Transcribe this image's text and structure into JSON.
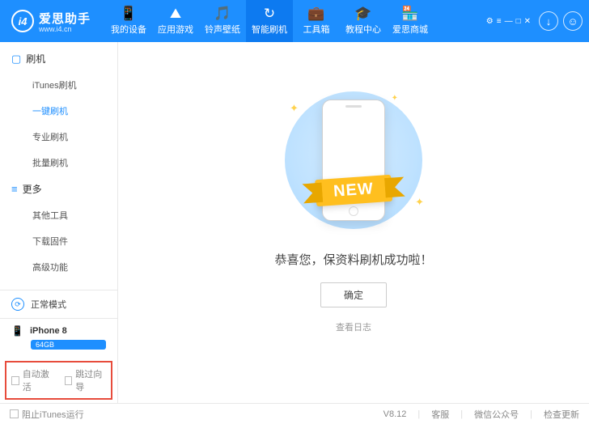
{
  "header": {
    "logo_badge": "i4",
    "app_name": "爱思助手",
    "url": "www.i4.cn",
    "nav": [
      {
        "icon": "📱",
        "label": "我的设备"
      },
      {
        "icon": "⛰",
        "label": "应用游戏"
      },
      {
        "icon": "🎵",
        "label": "铃声壁纸"
      },
      {
        "icon": "↻",
        "label": "智能刷机"
      },
      {
        "icon": "💼",
        "label": "工具箱"
      },
      {
        "icon": "🎓",
        "label": "教程中心"
      },
      {
        "icon": "🏪",
        "label": "爱思商城"
      }
    ],
    "download_icon": "↓",
    "user_icon": "👤"
  },
  "sidebar": {
    "section1": {
      "icon": "▢",
      "title": "刷机"
    },
    "items1": [
      "iTunes刷机",
      "一键刷机",
      "专业刷机",
      "批量刷机"
    ],
    "section2": {
      "icon": "≡",
      "title": "更多"
    },
    "items2": [
      "其他工具",
      "下载固件",
      "高级功能"
    ],
    "mode": {
      "icon": "⟳",
      "label": "正常模式"
    },
    "device": {
      "icon": "📱",
      "name": "iPhone 8",
      "storage": "64GB"
    },
    "checks": {
      "auto_activate": "自动激活",
      "skip_guide": "跳过向导"
    }
  },
  "main": {
    "ribbon": "NEW",
    "message": "恭喜您，保资料刷机成功啦！",
    "confirm": "确定",
    "log": "查看日志"
  },
  "footer": {
    "block_itunes": "阻止iTunes运行",
    "version": "V8.12",
    "support": "客服",
    "wechat": "微信公众号",
    "update": "检查更新"
  }
}
